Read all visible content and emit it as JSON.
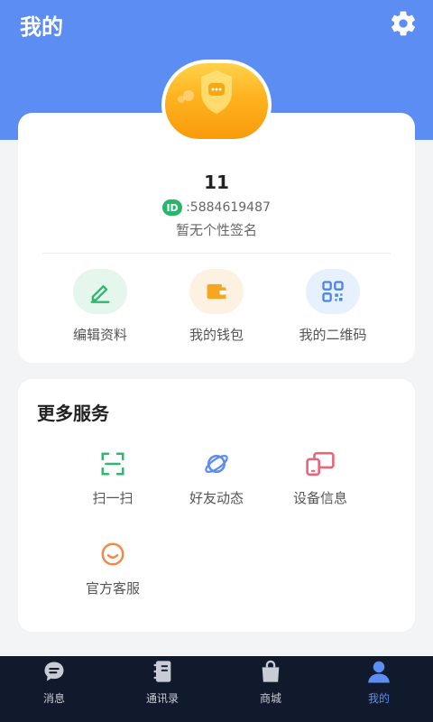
{
  "header": {
    "title": "我的",
    "settings_icon": "gear-icon"
  },
  "profile": {
    "avatar_icon": "shield-chat-avatar",
    "nickname": "11",
    "id_badge": "ID",
    "id_value": ":5884619487",
    "signature": "暂无个性签名"
  },
  "actions": [
    {
      "label": "编辑资料",
      "icon": "pencil-icon",
      "color": "#2fb86f"
    },
    {
      "label": "我的钱包",
      "icon": "wallet-icon",
      "color": "#f5a623"
    },
    {
      "label": "我的二维码",
      "icon": "qr-code-icon",
      "color": "#4a86e8"
    }
  ],
  "services": {
    "title": "更多服务",
    "items": [
      {
        "label": "扫一扫",
        "icon": "scan-icon",
        "color": "#2fb86f"
      },
      {
        "label": "好友动态",
        "icon": "planet-icon",
        "color": "#5b8df3"
      },
      {
        "label": "设备信息",
        "icon": "devices-icon",
        "color": "#e8667a"
      },
      {
        "label": "官方客服",
        "icon": "smile-icon",
        "color": "#f08a4b"
      }
    ]
  },
  "tabbar": {
    "items": [
      {
        "label": "消息",
        "icon": "chat-bubble-icon"
      },
      {
        "label": "通讯录",
        "icon": "contacts-book-icon"
      },
      {
        "label": "商城",
        "icon": "shopping-bag-icon"
      },
      {
        "label": "我的",
        "icon": "person-icon",
        "active": true
      }
    ],
    "active_color": "#5b8df3"
  },
  "colors": {
    "primary": "#5b8df3",
    "id_badge": "#28b66a",
    "avatar": "#f7a614"
  }
}
